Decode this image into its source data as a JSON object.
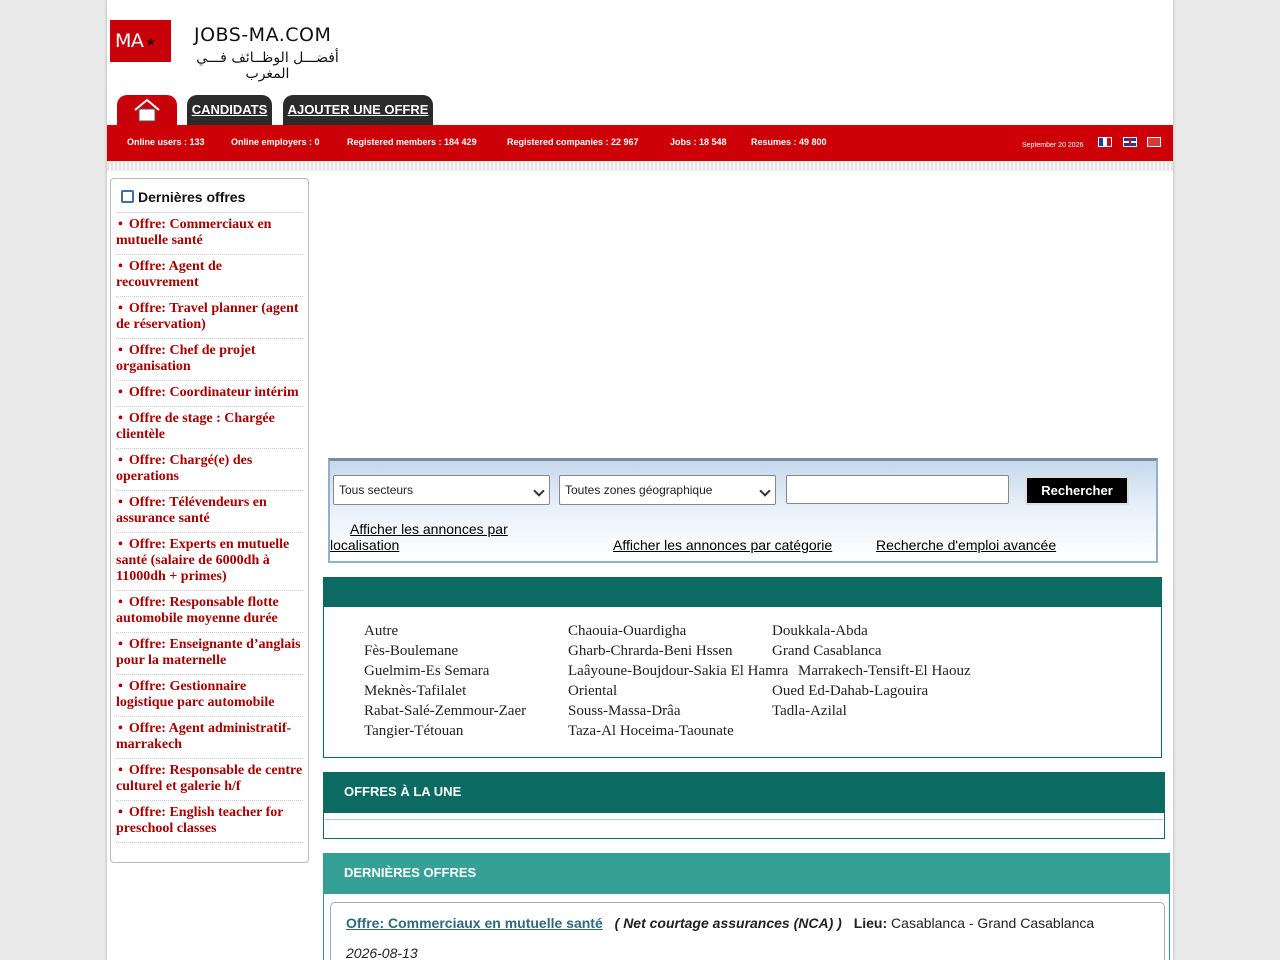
{
  "header": {
    "logo_badge": "MA",
    "logo_name": "JOBS-MA.COM",
    "logo_tagline": "أفضـــل الوظــائف فـــي المغرب"
  },
  "nav": {
    "home_icon": "home-icon",
    "candidats": "CANDIDATS",
    "ajouter": "AJOUTER UNE OFFRE"
  },
  "stats": {
    "online_users": "Online users : 133",
    "online_employers": "Online employers : 0",
    "registered_members": "Registered members : 184 429",
    "registered_companies": "Registered companies : 22 967",
    "jobs": "Jobs : 18 548",
    "resumes": "Resumes : 49 800",
    "date": "September 20 2026"
  },
  "sidebar": {
    "title": "Dernières offres",
    "items": [
      "Offre: Commerciaux en mutuelle santé",
      "Offre: Agent de recouvrement",
      "Offre: Travel planner (agent de réservation)",
      "Offre: Chef de projet organisation",
      "Offre: Coordinateur intérim",
      "Offre de stage : Chargée clientèle",
      "Offre: Chargé(e) des operations",
      "Offre: Télévendeurs en assurance santé",
      "Offre: Experts en mutuelle santé (salaire de 6000dh à 11000dh + primes)",
      "Offre: Responsable flotte automobile moyenne durée",
      "Offre: Enseignante d’anglais pour la maternelle",
      "Offre: Gestionnaire logistique parc automobile",
      "Offre: Agent administratif- marrakech",
      "Offre: Responsable de centre culturel et galerie h/f",
      "Offre: English teacher for preschool classes"
    ]
  },
  "search": {
    "secteur_selected": "Tous secteurs",
    "zone_selected": "Toutes zones géographique",
    "input_value": "",
    "button": "Rechercher",
    "link_localisation": "Afficher les annonces par localisation",
    "link_categorie": "Afficher les annonces par catégorie",
    "link_avancee": "Recherche d'emploi avancée "
  },
  "regions": [
    "Autre",
    "Chaouia-Ouardigha",
    "Doukkala-Abda",
    "Fès-Boulemane",
    "Gharb-Chrarda-Beni Hssen",
    "Grand Casablanca",
    "Guelmim-Es Semara",
    "Laâyoune-Boujdour-Sakia El Hamra",
    "Marrakech-Tensift-El Haouz",
    "Meknès-Tafilalet",
    "Oriental",
    "Oued Ed-Dahab-Lagouira",
    "Rabat-Salé-Zemmour-Zaer",
    "Souss-Massa-Drâa",
    "Tadla-Azilal",
    "Tangier-Tétouan",
    "Taza-Al Hoceima-Taounate"
  ],
  "une": {
    "title": "OFFRES À LA UNE"
  },
  "latest": {
    "title": "DERNIÈRES OFFRES",
    "offer": {
      "title": "Offre: Commerciaux en mutuelle santé",
      "company": "( Net courtage assurances (NCA) )",
      "lieu_label": "Lieu:",
      "lieu": "Casablanca - Grand Casablanca",
      "date": "2026-08-13"
    }
  },
  "colors": {
    "brand_red": "#cc0006",
    "teal": "#0b6b63",
    "teal_light": "#35a095",
    "link_red": "#a60000"
  }
}
